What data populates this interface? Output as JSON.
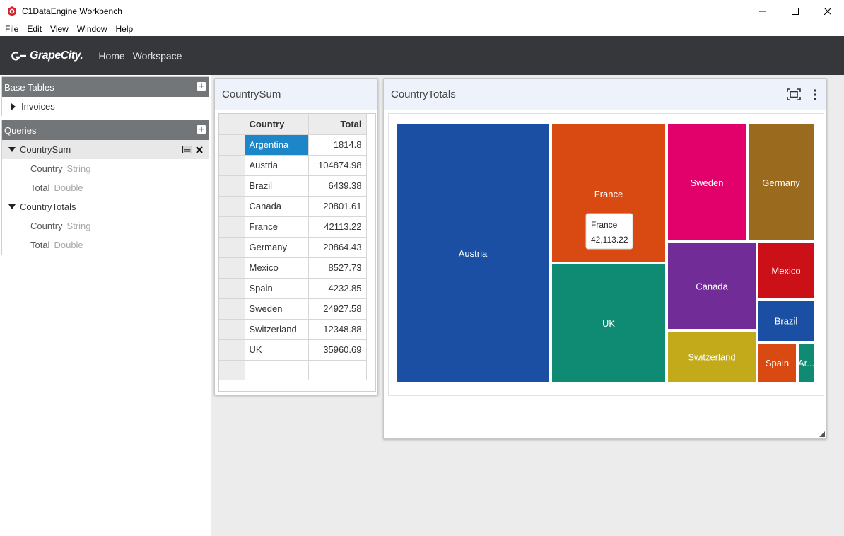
{
  "window": {
    "title": "C1DataEngine Workbench",
    "controls": [
      "minimize",
      "maximize",
      "close"
    ]
  },
  "menu": [
    "File",
    "Edit",
    "View",
    "Window",
    "Help"
  ],
  "header": {
    "brand": "GrapeCity.",
    "nav": [
      "Home",
      "Workspace"
    ]
  },
  "sidebar": {
    "base_tables": {
      "title": "Base Tables",
      "items": [
        {
          "label": "Invoices"
        }
      ]
    },
    "queries": {
      "title": "Queries",
      "items": [
        {
          "label": "CountrySum",
          "fields": [
            {
              "name": "Country",
              "type": "String"
            },
            {
              "name": "Total",
              "type": "Double"
            }
          ]
        },
        {
          "label": "CountryTotals",
          "fields": [
            {
              "name": "Country",
              "type": "String"
            },
            {
              "name": "Total",
              "type": "Double"
            }
          ]
        }
      ]
    }
  },
  "country_sum": {
    "title": "CountrySum",
    "columns": [
      "Country",
      "Total"
    ],
    "rows": [
      [
        "Argentina",
        "1814.8"
      ],
      [
        "Austria",
        "104874.98"
      ],
      [
        "Brazil",
        "6439.38"
      ],
      [
        "Canada",
        "20801.61"
      ],
      [
        "France",
        "42113.22"
      ],
      [
        "Germany",
        "20864.43"
      ],
      [
        "Mexico",
        "8527.73"
      ],
      [
        "Spain",
        "4232.85"
      ],
      [
        "Sweden",
        "24927.58"
      ],
      [
        "Switzerland",
        "12348.88"
      ],
      [
        "UK",
        "35960.69"
      ]
    ]
  },
  "country_totals": {
    "title": "CountryTotals",
    "tooltip": {
      "label": "France",
      "value": "42,113.22"
    }
  },
  "chart_data": {
    "type": "treemap",
    "series": [
      {
        "name": "Austria",
        "value": 104874.98,
        "color": "#1a4fa3",
        "label": "Austria"
      },
      {
        "name": "France",
        "value": 42113.22,
        "color": "#d84a12",
        "label": "France"
      },
      {
        "name": "UK",
        "value": 35960.69,
        "color": "#0e8b72",
        "label": "UK"
      },
      {
        "name": "Sweden",
        "value": 24927.58,
        "color": "#e2006a",
        "label": "Sweden"
      },
      {
        "name": "Germany",
        "value": 20864.43,
        "color": "#9a6a1e",
        "label": "Germany"
      },
      {
        "name": "Canada",
        "value": 20801.61,
        "color": "#722c97",
        "label": "Canada"
      },
      {
        "name": "Switzerland",
        "value": 12348.88,
        "color": "#c2aa1b",
        "label": "Switzerland"
      },
      {
        "name": "Mexico",
        "value": 8527.73,
        "color": "#cc1018",
        "label": "Mexico"
      },
      {
        "name": "Brazil",
        "value": 6439.38,
        "color": "#1a4fa3",
        "label": "Brazil"
      },
      {
        "name": "Spain",
        "value": 4232.85,
        "color": "#d84a12",
        "label": "Spain"
      },
      {
        "name": "Argentina",
        "value": 1814.8,
        "color": "#0e8b72",
        "label": "Ar..."
      }
    ]
  }
}
